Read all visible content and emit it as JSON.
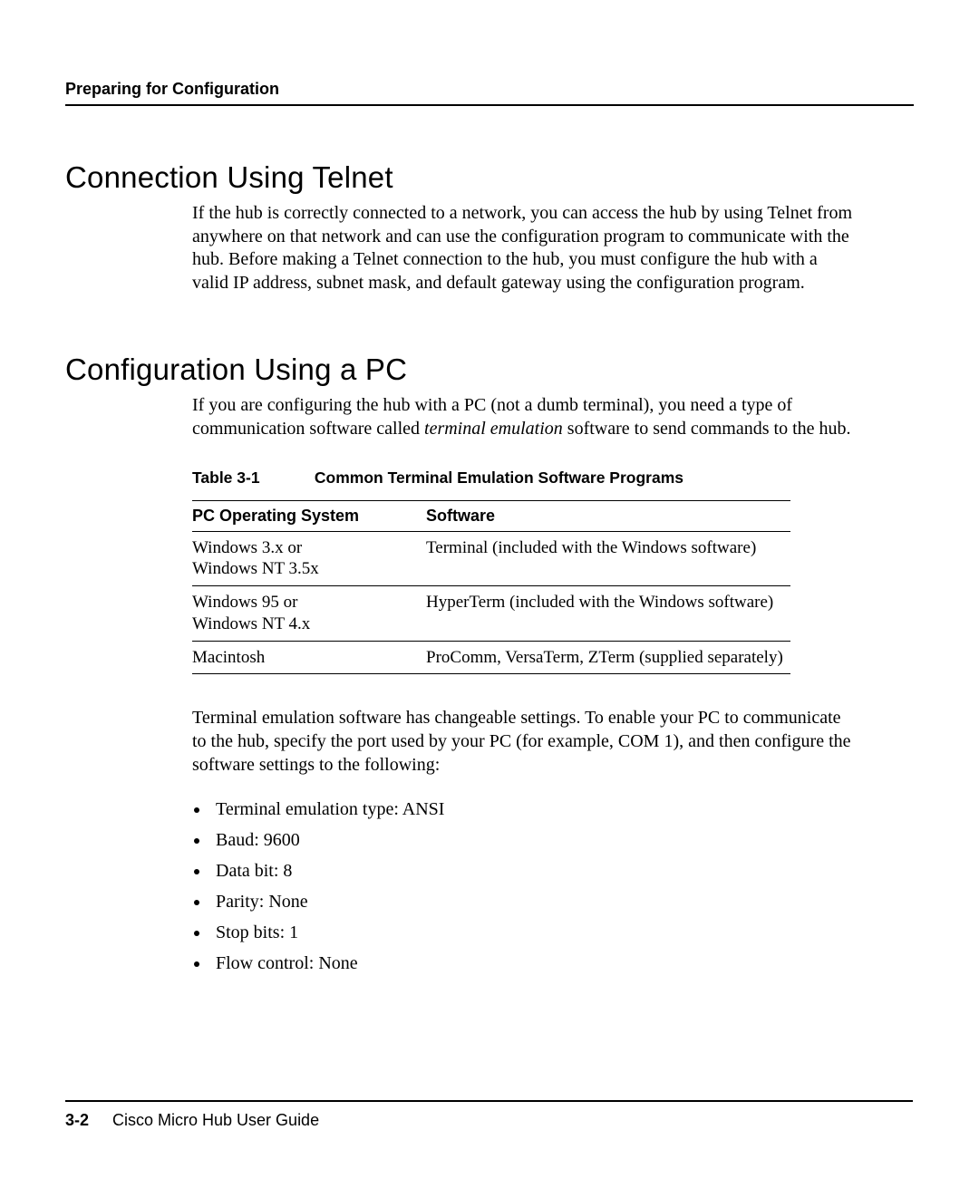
{
  "header": {
    "running_head": "Preparing for Configuration"
  },
  "section1": {
    "title": "Connection Using Telnet",
    "para": "If the hub is correctly connected to a network, you can access the hub by using Telnet from anywhere on that network and can use the configuration program to communicate with the hub. Before making a Telnet connection to the hub, you must configure the hub with a valid IP address, subnet mask, and default gateway using the configuration program."
  },
  "section2": {
    "title": "Configuration Using a PC",
    "para_pre": "If you are configuring the hub with a PC (not a dumb terminal), you need a type of communication software called ",
    "para_italic": "terminal emulation",
    "para_post": " software to send commands to the hub."
  },
  "table": {
    "caption_label": "Table 3-1",
    "caption_title": "Common Terminal Emulation Software Programs",
    "headers": {
      "os": "PC Operating System",
      "sw": "Software"
    },
    "rows": [
      {
        "os_line1": "Windows 3.x or",
        "os_line2": "Windows NT 3.5x",
        "sw": "Terminal (included with the Windows software)"
      },
      {
        "os_line1": "Windows 95 or",
        "os_line2": "Windows NT 4.x",
        "sw": "HyperTerm (included with the Windows software)"
      },
      {
        "os_line1": "Macintosh",
        "os_line2": "",
        "sw": "ProComm, VersaTerm, ZTerm (supplied separately)"
      }
    ]
  },
  "para3": "Terminal emulation software has changeable settings. To enable your PC to communicate to the hub, specify the port used by your PC (for example, COM 1), and then configure the software settings to the following:",
  "settings": [
    "Terminal emulation type: ANSI",
    "Baud: 9600",
    "Data bit: 8",
    "Parity: None",
    "Stop bits: 1",
    "Flow control: None"
  ],
  "footer": {
    "page": "3-2",
    "guide": "Cisco Micro Hub User Guide"
  }
}
